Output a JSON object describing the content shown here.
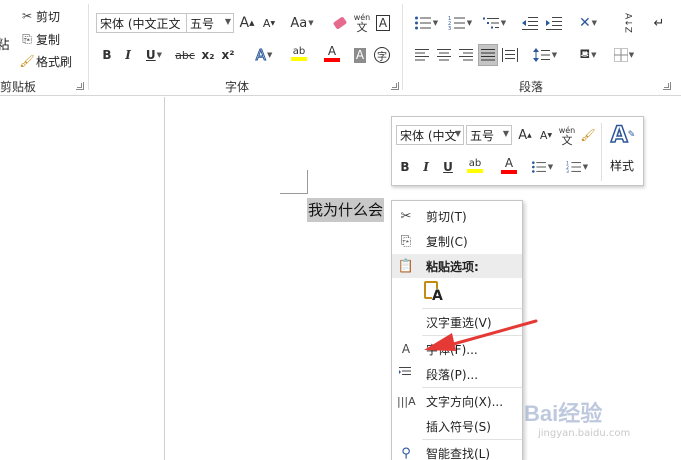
{
  "clipboard": {
    "paste_label": "粘",
    "cut": "剪切",
    "copy": "复制",
    "format_painter": "格式刷",
    "group_label": "剪贴板"
  },
  "font_group": {
    "font_name": "宋体 (中文正文",
    "font_size": "五号",
    "grow": "A",
    "shrink": "A",
    "case": "Aa",
    "phonetic_top": "wén",
    "phonetic_bottom": "文",
    "border_char": "A",
    "bold": "B",
    "italic": "I",
    "underline": "U",
    "strike": "abc",
    "sub": "x₂",
    "sup": "x²",
    "effects": "A",
    "highlight": "ab",
    "font_color": "A",
    "shade": "A",
    "enclose": "字",
    "group_label": "字体"
  },
  "paragraph_group": {
    "sort": "A↓Z",
    "group_label": "段落"
  },
  "mini_toolbar": {
    "font_name": "宋体 (中文",
    "font_size": "五号",
    "grow": "A",
    "shrink": "A",
    "phonetic_top": "wén",
    "phonetic_bottom": "文",
    "bold": "B",
    "italic": "I",
    "underline": "U",
    "highlight": "ab",
    "font_color": "A",
    "styles_label": "样式"
  },
  "document": {
    "selected_text": "我为什么会"
  },
  "context_menu": {
    "items": [
      {
        "label": "剪切(T)"
      },
      {
        "label": "复制(C)"
      },
      {
        "label": "粘贴选项:"
      },
      {
        "label": "A"
      },
      {
        "label": "汉字重选(V)"
      },
      {
        "label": "字体(F)..."
      },
      {
        "label": "段落(P)..."
      },
      {
        "label": "文字方向(X)..."
      },
      {
        "label": "插入符号(S)"
      },
      {
        "label": "智能查找(L)"
      }
    ]
  },
  "watermark": {
    "text": "Bai经验",
    "url": "jingyan.baidu.com"
  },
  "colors": {
    "highlight_yellow": "#ffff00",
    "font_red": "#ff0000",
    "arrow_red": "#e53935",
    "accent_blue": "#2b579a"
  }
}
